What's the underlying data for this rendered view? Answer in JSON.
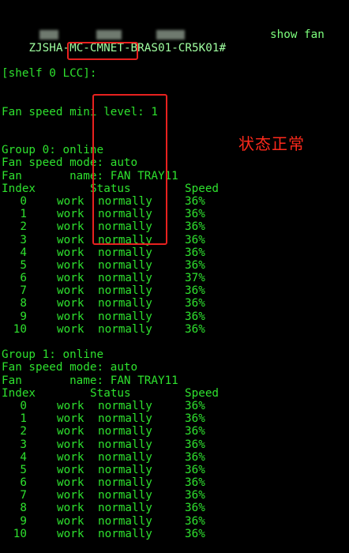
{
  "prompt": "ZJSHA-MC-CMNET-BRAS01-CR5K01#",
  "command": "show fan",
  "shelf_line": "[shelf 0 LCC]:",
  "min_level_line": "Fan speed mini level: 1",
  "groups": [
    {
      "label": "Group 0:",
      "state": "online",
      "mode_line": "Fan speed mode: auto",
      "name_line": "Fan       name: FAN TRAY11",
      "headers": {
        "index": "Index",
        "status": "Status",
        "speed": "Speed"
      },
      "rows": [
        {
          "index": "0",
          "state": "work",
          "status": "normally",
          "speed": "36%"
        },
        {
          "index": "1",
          "state": "work",
          "status": "normally",
          "speed": "36%"
        },
        {
          "index": "2",
          "state": "work",
          "status": "normally",
          "speed": "36%"
        },
        {
          "index": "3",
          "state": "work",
          "status": "normally",
          "speed": "36%"
        },
        {
          "index": "4",
          "state": "work",
          "status": "normally",
          "speed": "36%"
        },
        {
          "index": "5",
          "state": "work",
          "status": "normally",
          "speed": "36%"
        },
        {
          "index": "6",
          "state": "work",
          "status": "normally",
          "speed": "37%"
        },
        {
          "index": "7",
          "state": "work",
          "status": "normally",
          "speed": "36%"
        },
        {
          "index": "8",
          "state": "work",
          "status": "normally",
          "speed": "36%"
        },
        {
          "index": "9",
          "state": "work",
          "status": "normally",
          "speed": "36%"
        },
        {
          "index": "10",
          "state": "work",
          "status": "normally",
          "speed": "36%"
        }
      ]
    },
    {
      "label": "Group 1:",
      "state": "online",
      "mode_line": "Fan speed mode: auto",
      "name_line": "Fan       name: FAN TRAY11",
      "headers": {
        "index": "Index",
        "status": "Status",
        "speed": "Speed"
      },
      "rows": [
        {
          "index": "0",
          "state": "work",
          "status": "normally",
          "speed": "36%"
        },
        {
          "index": "1",
          "state": "work",
          "status": "normally",
          "speed": "36%"
        },
        {
          "index": "2",
          "state": "work",
          "status": "normally",
          "speed": "36%"
        },
        {
          "index": "3",
          "state": "work",
          "status": "normally",
          "speed": "36%"
        },
        {
          "index": "4",
          "state": "work",
          "status": "normally",
          "speed": "36%"
        },
        {
          "index": "5",
          "state": "work",
          "status": "normally",
          "speed": "36%"
        },
        {
          "index": "6",
          "state": "work",
          "status": "normally",
          "speed": "36%"
        },
        {
          "index": "7",
          "state": "work",
          "status": "normally",
          "speed": "36%"
        },
        {
          "index": "8",
          "state": "work",
          "status": "normally",
          "speed": "36%"
        },
        {
          "index": "9",
          "state": "work",
          "status": "normally",
          "speed": "36%"
        },
        {
          "index": "10",
          "state": "work",
          "status": "normally",
          "speed": "36%"
        }
      ]
    }
  ],
  "annotation": "状态正常",
  "colors": {
    "background": "#000000",
    "terminal_text": "#2ee12e",
    "annotation": "#e8211f"
  }
}
